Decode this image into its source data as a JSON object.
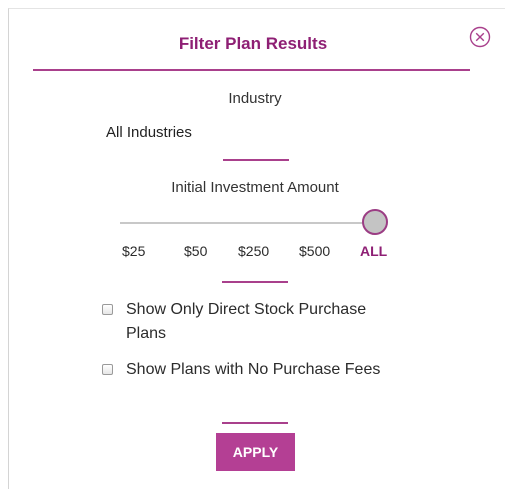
{
  "dialog": {
    "title": "Filter Plan Results",
    "close_icon": "close-circle-icon"
  },
  "industry": {
    "label": "Industry",
    "selected": "All Industries"
  },
  "investment": {
    "label": "Initial Investment Amount",
    "ticks": [
      "$25",
      "$50",
      "$250",
      "$500",
      "ALL"
    ],
    "selected": "ALL"
  },
  "filters": [
    {
      "label": "Show Only Direct Stock Purchase Plans",
      "checked": false
    },
    {
      "label": "Show Plans with No Purchase Fees",
      "checked": false
    }
  ],
  "apply_label": "APPLY",
  "colors": {
    "accent": "#8e1f74",
    "button": "#b43f94",
    "rule": "#a9408c"
  }
}
